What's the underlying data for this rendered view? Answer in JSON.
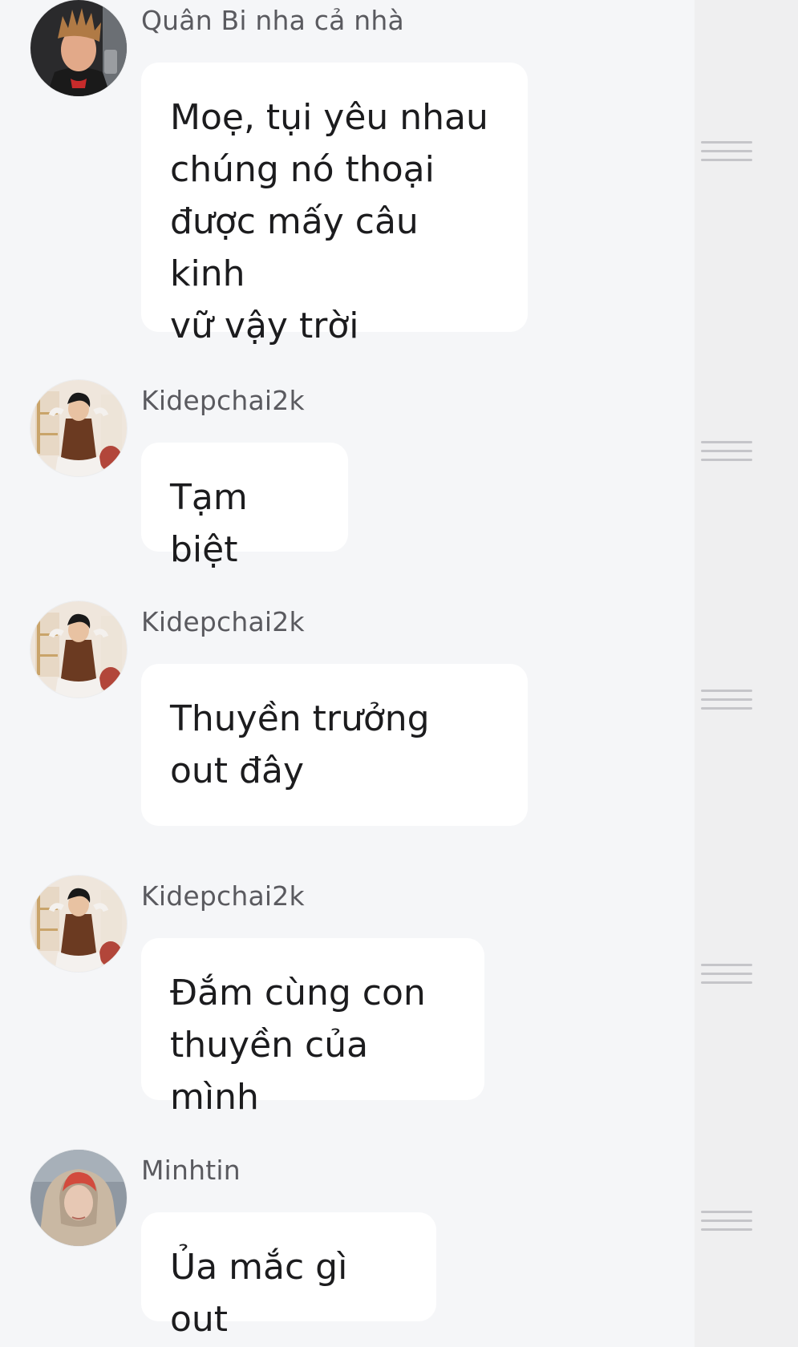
{
  "messages": [
    {
      "sender": "Quân Bi nha cả nhà",
      "text": "Moẹ, tụi yêu nhau\nchúng nó thoại\nđược mấy câu kinh\nvữ vậy trời",
      "avatar_icon": "user-avatar-photo-spiky-hair"
    },
    {
      "sender": "Kidepchai2k",
      "text": "Tạm biệt",
      "avatar_icon": "user-avatar-photo-brown-scarf"
    },
    {
      "sender": "Kidepchai2k",
      "text": "Thuyền trưởng\nout đây",
      "avatar_icon": "user-avatar-photo-brown-scarf"
    },
    {
      "sender": "Kidepchai2k",
      "text": "Đắm cùng con\nthuyền của mình",
      "avatar_icon": "user-avatar-photo-brown-scarf"
    },
    {
      "sender": "Minhtin",
      "text": "Ủa mắc gì out",
      "avatar_icon": "user-avatar-photo-red-hair-hood"
    }
  ],
  "colors": {
    "background": "#f5f6f8",
    "bubble": "#ffffff",
    "rail": "#efeff0",
    "sender_text": "#5a5a5f",
    "message_text": "#1c1c1e"
  }
}
